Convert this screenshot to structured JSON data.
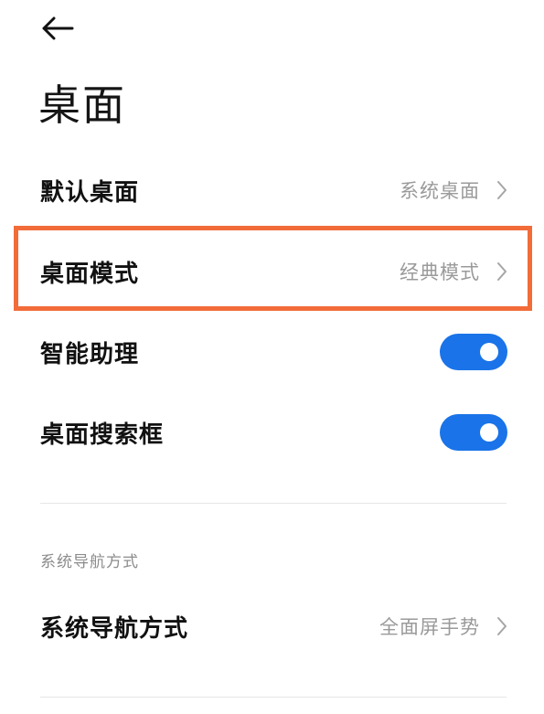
{
  "header": {
    "back_icon": "arrow-left-icon",
    "title": "桌面"
  },
  "rows": [
    {
      "label": "默认桌面",
      "value": "系统桌面",
      "type": "link"
    },
    {
      "label": "桌面模式",
      "value": "经典模式",
      "type": "link",
      "highlighted": true
    },
    {
      "label": "智能助理",
      "type": "toggle",
      "checked": true
    },
    {
      "label": "桌面搜索框",
      "type": "toggle",
      "checked": true
    }
  ],
  "section": {
    "header": "系统导航方式",
    "row": {
      "label": "系统导航方式",
      "value": "全面屏手势",
      "type": "link"
    }
  },
  "colors": {
    "toggle_on": "#1a73e8",
    "highlight": "#f26c3a",
    "secondary_text": "#9a9a9a"
  }
}
